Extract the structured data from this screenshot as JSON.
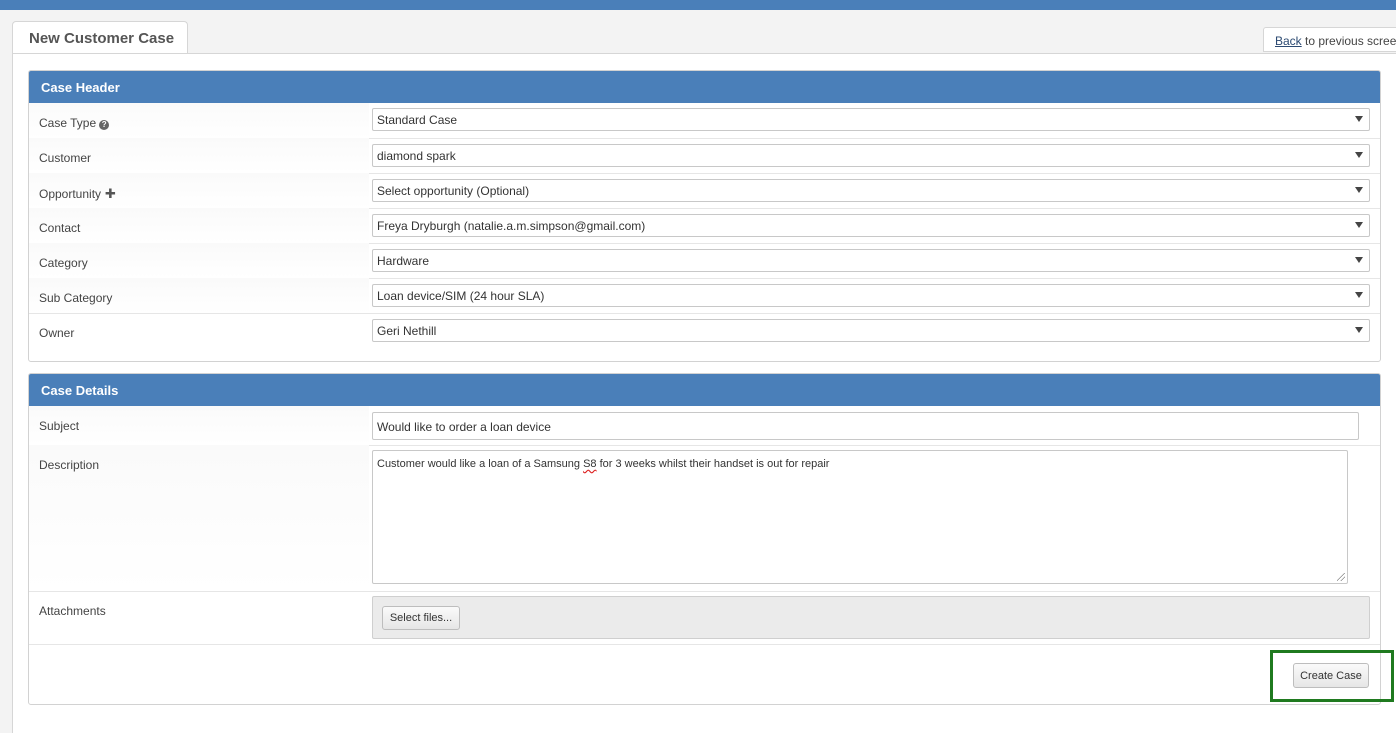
{
  "page": {
    "title": "New Customer Case",
    "back_link": "Back",
    "back_suffix": " to previous screen"
  },
  "case_header": {
    "title": "Case Header",
    "fields": [
      {
        "label": "Case Type",
        "value": "Standard Case"
      },
      {
        "label": "Customer",
        "value": "diamond spark"
      },
      {
        "label": "Opportunity",
        "value": "Select opportunity (Optional)"
      },
      {
        "label": "Contact",
        "value": "Freya Dryburgh (natalie.a.m.simpson@gmail.com)"
      },
      {
        "label": "Category",
        "value": "Hardware"
      },
      {
        "label": "Sub Category",
        "value": "Loan device/SIM (24 hour SLA)"
      },
      {
        "label": "Owner",
        "value": "Geri Nethill"
      }
    ],
    "help_icon": "question-circle-icon",
    "plus_icon": "plus-icon"
  },
  "case_details": {
    "title": "Case Details",
    "subject_label": "Subject",
    "subject_value": "Would like to order a loan device",
    "description_label": "Description",
    "description_before": "Customer would like a loan of a Samsung ",
    "description_misspelled": "S8",
    "description_after": " for 3 weeks whilst their handset is out for repair",
    "attachments_label": "Attachments",
    "select_files_label": "Select files...",
    "create_case_label": "Create Case"
  },
  "colors": {
    "accent": "#4a7fb9",
    "highlight": "#1f7a1f"
  }
}
